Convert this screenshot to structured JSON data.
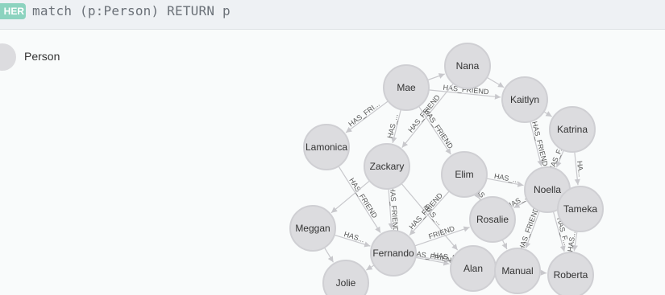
{
  "query": {
    "language_badge": "HER",
    "text": "match (p:Person) RETURN p"
  },
  "legend": {
    "label": "Person"
  },
  "graph": {
    "node_label": "Person",
    "nodes": [
      {
        "id": "Nana"
      },
      {
        "id": "Mae"
      },
      {
        "id": "Kaitlyn"
      },
      {
        "id": "Katrina"
      },
      {
        "id": "Lamonica"
      },
      {
        "id": "Zackary"
      },
      {
        "id": "Elim"
      },
      {
        "id": "Noella"
      },
      {
        "id": "Tameka"
      },
      {
        "id": "Meggan"
      },
      {
        "id": "Rosalie"
      },
      {
        "id": "Fernando"
      },
      {
        "id": "Alan"
      },
      {
        "id": "Manual"
      },
      {
        "id": "Roberta"
      },
      {
        "id": "Jolie"
      }
    ],
    "relationships": [
      {
        "from": "Mae",
        "to": "Nana",
        "label": ""
      },
      {
        "from": "Mae",
        "to": "Kaitlyn",
        "label": "HAS_FRIEND"
      },
      {
        "from": "Nana",
        "to": "Kaitlyn",
        "label": ""
      },
      {
        "from": "Mae",
        "to": "Lamonica",
        "label": "HAS_FRI..."
      },
      {
        "from": "Mae",
        "to": "Zackary",
        "label": "HAS_..."
      },
      {
        "from": "Nana",
        "to": "Zackary",
        "label": "HAS_FRIEND"
      },
      {
        "from": "Mae",
        "to": "Elim",
        "label": "HAS_FRIEND"
      },
      {
        "from": "Kaitlyn",
        "to": "Katrina",
        "label": ""
      },
      {
        "from": "Kaitlyn",
        "to": "Noella",
        "label": "HAS_FRIEND"
      },
      {
        "from": "Katrina",
        "to": "Noella",
        "label": "HAS_F..."
      },
      {
        "from": "Katrina",
        "to": "Tameka",
        "label": "HA..."
      },
      {
        "from": "Lamonica",
        "to": "Fernando",
        "label": "HAS_FRIEND"
      },
      {
        "from": "Zackary",
        "to": "Fernando",
        "label": "HAS_FRIEND"
      },
      {
        "from": "Zackary",
        "to": "Meggan",
        "label": ""
      },
      {
        "from": "Zackary",
        "to": "Alan",
        "label": "HAS_..."
      },
      {
        "from": "Elim",
        "to": "Fernando",
        "label": "HAS_FRIEND"
      },
      {
        "from": "Elim",
        "to": "Noella",
        "label": "HAS_..."
      },
      {
        "from": "Elim",
        "to": "Rosalie",
        "label": "HAS_..."
      },
      {
        "from": "Noella",
        "to": "Rosalie",
        "label": "HAS_..."
      },
      {
        "from": "Noella",
        "to": "Tameka",
        "label": ""
      },
      {
        "from": "Noella",
        "to": "Manual",
        "label": "HAS_FRIEND"
      },
      {
        "from": "Noella",
        "to": "Roberta",
        "label": "HAS_F..."
      },
      {
        "from": "Tameka",
        "to": "Roberta",
        "label": "HAS..."
      },
      {
        "from": "Meggan",
        "to": "Fernando",
        "label": "HAS..."
      },
      {
        "from": "Meggan",
        "to": "Jolie",
        "label": ""
      },
      {
        "from": "Fernando",
        "to": "Rosalie",
        "label": "FRIEND"
      },
      {
        "from": "Fernando",
        "to": "Alan",
        "label": "HAS_FRIEND"
      },
      {
        "from": "Fernando",
        "to": "Manual",
        "label": "HAS_FRIEND"
      },
      {
        "from": "Fernando",
        "to": "Jolie",
        "label": ""
      },
      {
        "from": "Rosalie",
        "to": "Manual",
        "label": ""
      },
      {
        "from": "Alan",
        "to": "Manual",
        "label": ""
      },
      {
        "from": "Manual",
        "to": "Roberta",
        "label": ""
      }
    ]
  }
}
